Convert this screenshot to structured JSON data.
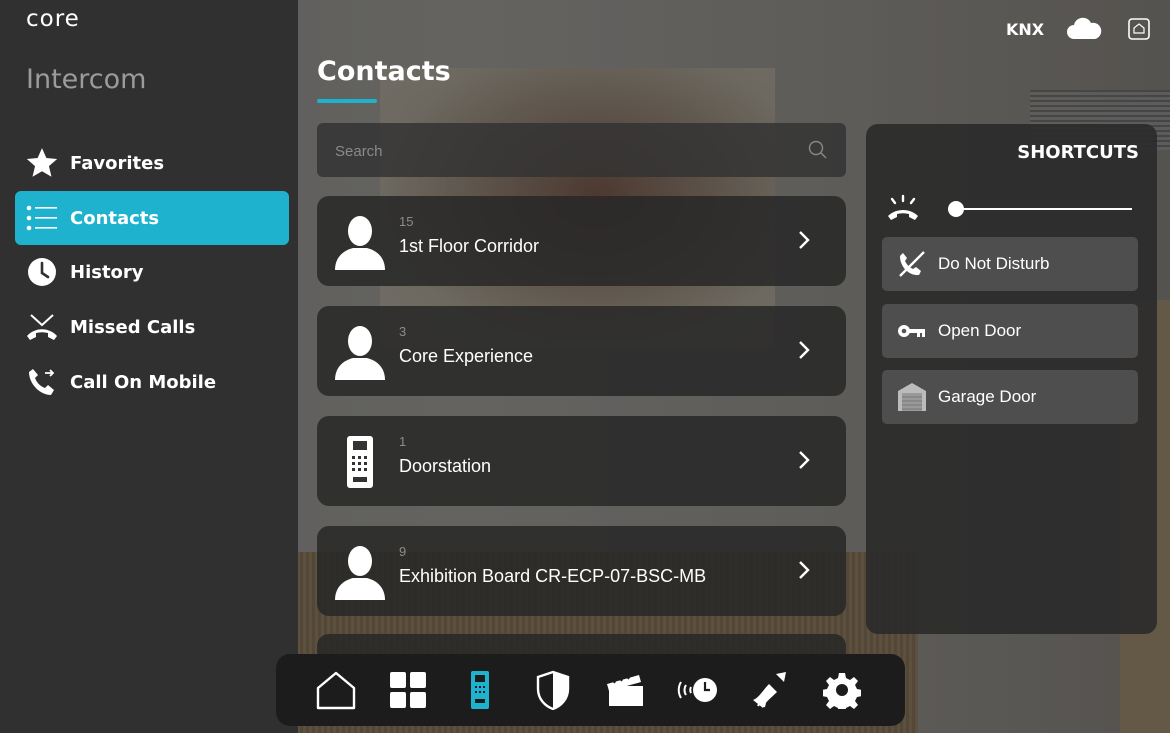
{
  "app": {
    "logo": "core",
    "title": "Intercom"
  },
  "status": {
    "knx": "KNX",
    "cloud_icon": "cloud-icon",
    "home_icon": "home-box-icon"
  },
  "sidebar": {
    "items": [
      {
        "label": "Favorites",
        "icon": "star-icon",
        "active": false
      },
      {
        "label": "Contacts",
        "icon": "list-icon",
        "active": true
      },
      {
        "label": "History",
        "icon": "clock-icon",
        "active": false
      },
      {
        "label": "Missed Calls",
        "icon": "missed-call-icon",
        "active": false
      },
      {
        "label": "Call On Mobile",
        "icon": "phone-forward-icon",
        "active": false
      }
    ]
  },
  "main": {
    "title": "Contacts",
    "search": {
      "placeholder": "Search",
      "value": ""
    },
    "contacts": [
      {
        "number": "15",
        "name": "1st Floor Corridor",
        "icon": "person-icon"
      },
      {
        "number": "3",
        "name": "Core Experience",
        "icon": "person-icon"
      },
      {
        "number": "1",
        "name": "Doorstation",
        "icon": "doorstation-icon"
      },
      {
        "number": "9",
        "name": "Exhibition Board CR-ECP-07-BSC-MB",
        "icon": "person-icon"
      }
    ]
  },
  "shortcuts": {
    "title": "SHORTCUTS",
    "volume_level": 0.0,
    "buttons": [
      {
        "label": "Do Not Disturb",
        "icon": "dnd-phone-icon"
      },
      {
        "label": "Open Door",
        "icon": "key-icon"
      },
      {
        "label": "Garage Door",
        "icon": "garage-icon"
      }
    ]
  },
  "dock": {
    "items": [
      "home-icon",
      "grid-icon",
      "intercom-icon",
      "security-shield-icon",
      "scene-clapper-icon",
      "timer-icon",
      "cleaning-icon",
      "settings-gear-icon"
    ],
    "active": "intercom-icon"
  },
  "colors": {
    "accent": "#1fb2cf",
    "sidebar": "#303030",
    "card": "#282828"
  }
}
